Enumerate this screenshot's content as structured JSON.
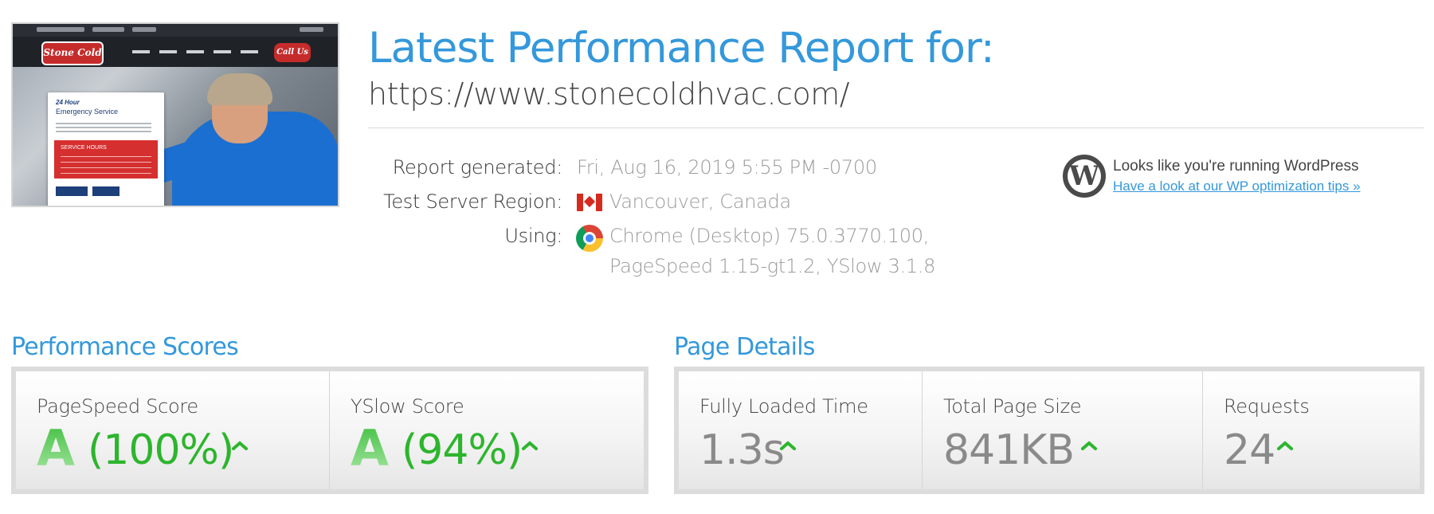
{
  "thumbnail": {
    "logo_text": "Stone Cold",
    "call_text": "Call Us",
    "card_kicker": "24 Hour",
    "card_title": "Emergency Service",
    "hours_label": "SERVICE HOURS"
  },
  "header": {
    "title": "Latest Performance Report for:",
    "url": "https://www.stonecoldhvac.com/"
  },
  "meta": {
    "report_generated_label": "Report generated:",
    "report_generated_value": "Fri, Aug 16, 2019 5:55 PM -0700",
    "region_label": "Test Server Region:",
    "region_value": "Vancouver, Canada",
    "using_label": "Using:",
    "using_value_line1": "Chrome (Desktop) 75.0.3770.100,",
    "using_value_line2": "PageSpeed 1.15-gt1.2, YSlow 3.1.8"
  },
  "wordpress": {
    "text": "Looks like you're running WordPress",
    "link": "Have a look at our WP optimization tips »"
  },
  "performance": {
    "title": "Performance Scores",
    "pagespeed": {
      "label": "PageSpeed Score",
      "grade": "A",
      "percent": "(100%)"
    },
    "yslow": {
      "label": "YSlow Score",
      "grade": "A",
      "percent": "(94%)"
    }
  },
  "details": {
    "title": "Page Details",
    "fully_loaded": {
      "label": "Fully Loaded Time",
      "value": "1.3s"
    },
    "page_size": {
      "label": "Total Page Size",
      "value": "841KB"
    },
    "requests": {
      "label": "Requests",
      "value": "24"
    }
  },
  "colors": {
    "accent_blue": "#3498db",
    "score_green": "#2db52d",
    "muted_value": "#8a8a8a"
  }
}
